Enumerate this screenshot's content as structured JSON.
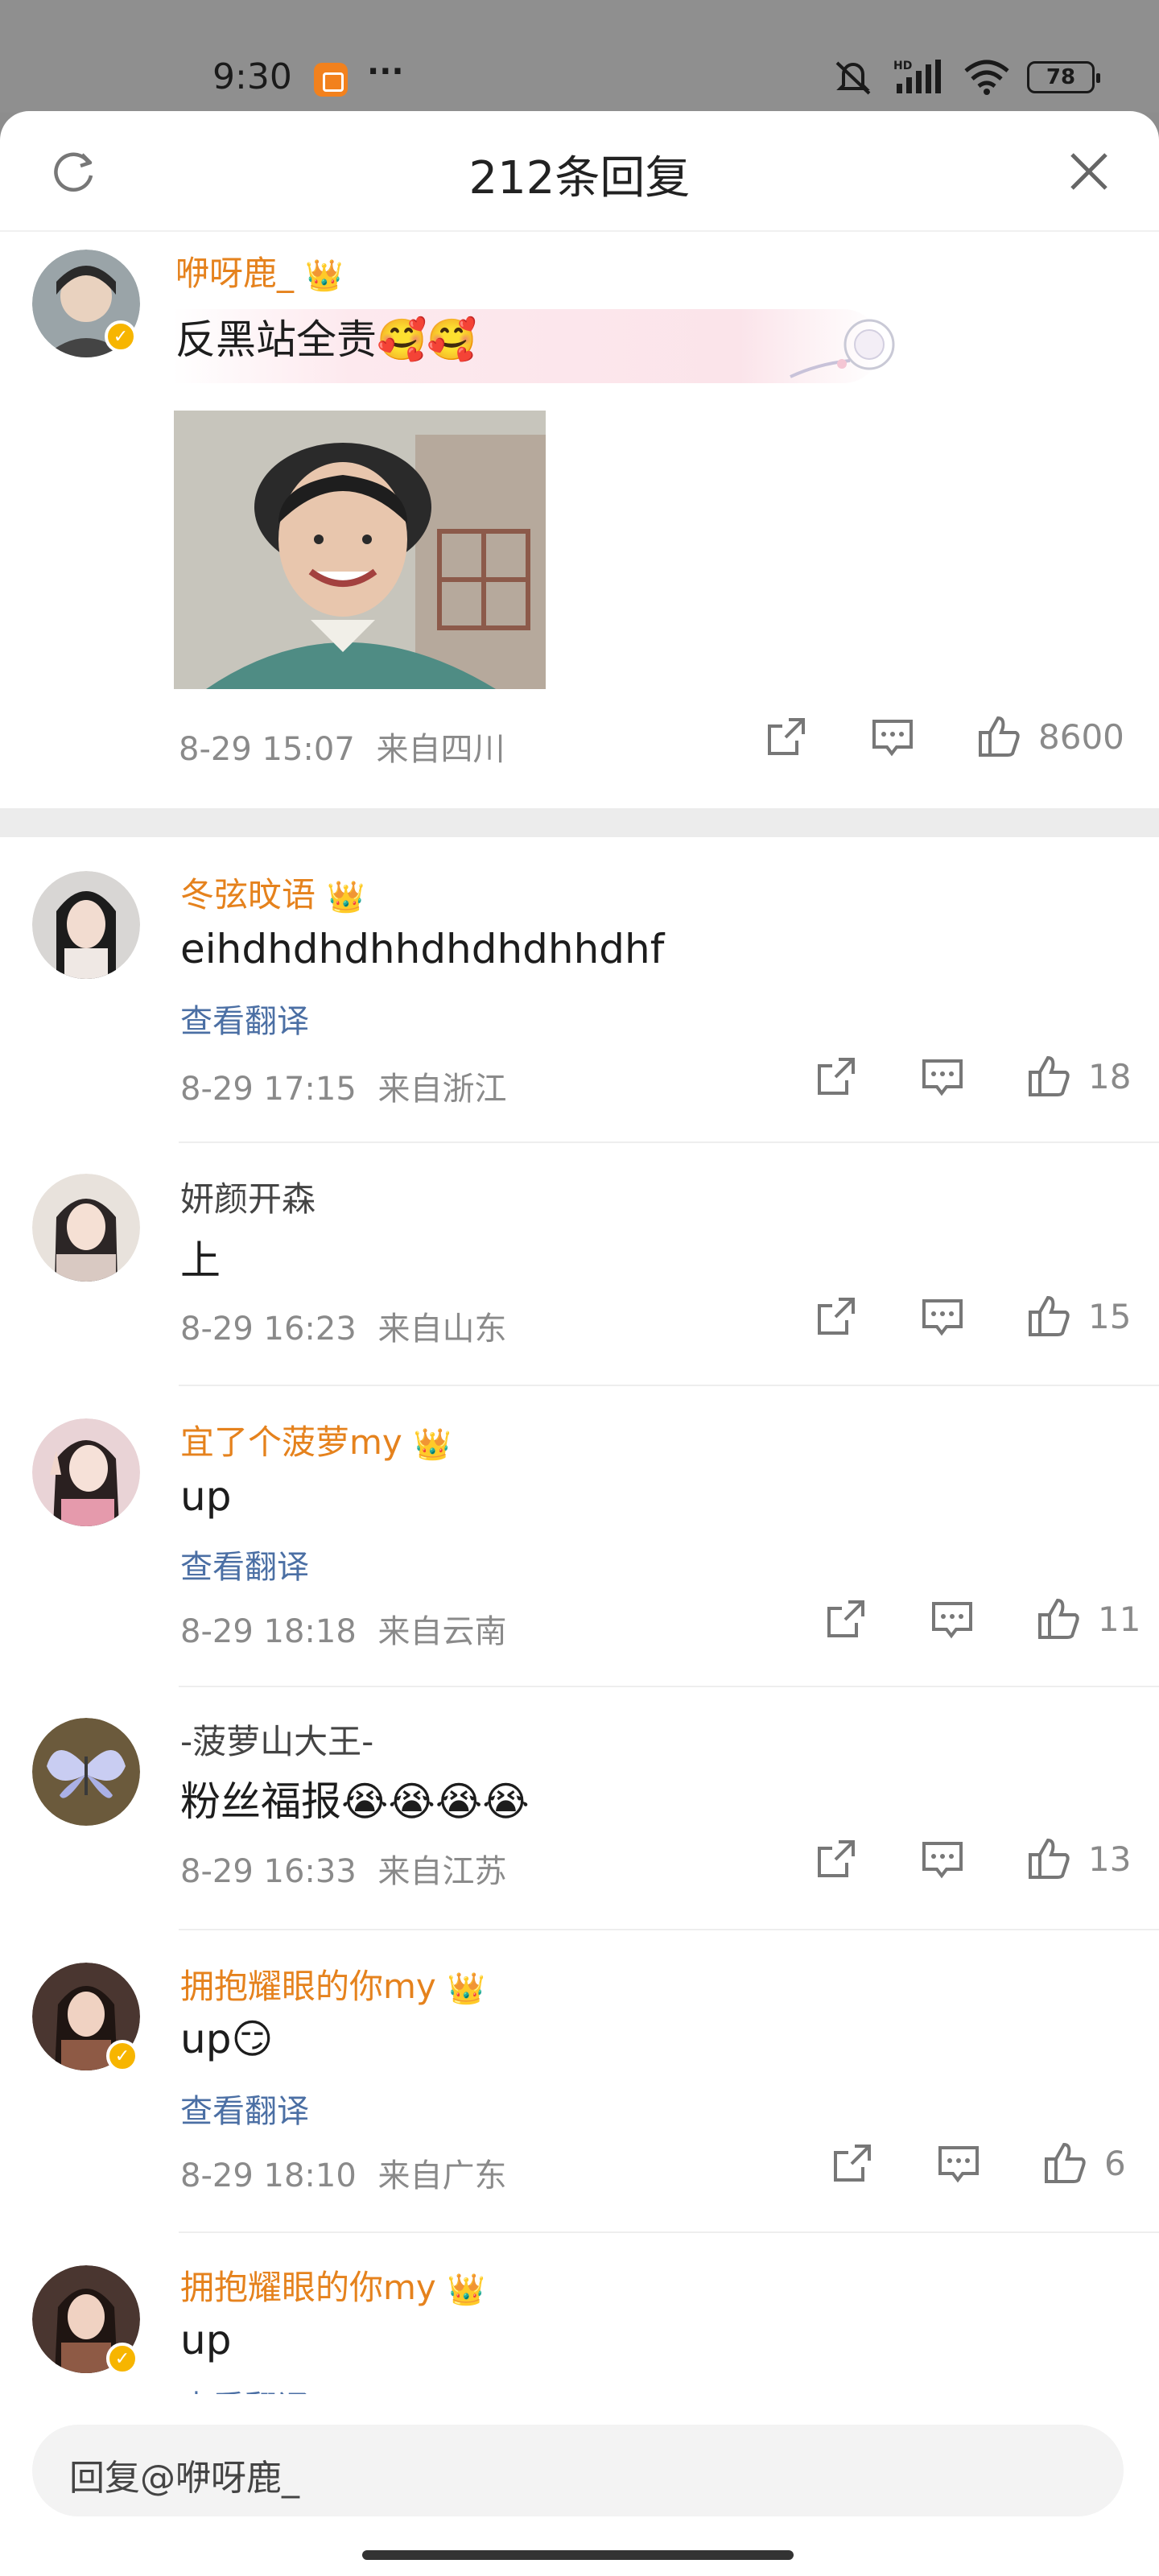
{
  "status_bar": {
    "time": "9:30",
    "dots": "···",
    "battery": "78",
    "icons": [
      "mute-icon",
      "hd-signal-icon",
      "wifi-icon",
      "battery-icon"
    ]
  },
  "header": {
    "title": "212条回复",
    "refresh_icon": "refresh-icon",
    "close_icon": "close-icon"
  },
  "main_comment": {
    "username": "咿呀鹿_",
    "text": "反黑站全责🥰🥰",
    "time": "8-29 15:07",
    "location": "来自四川",
    "likes": "8600"
  },
  "replies": [
    {
      "username": "冬弦旼语",
      "vip": true,
      "text": "eihdhdhdhhdhdhdhhdhf",
      "translate": "查看翻译",
      "time": "8-29 17:15",
      "location": "来自浙江",
      "likes": "18"
    },
    {
      "username": "妍颜开森",
      "vip": false,
      "text": "上",
      "translate": "",
      "time": "8-29 16:23",
      "location": "来自山东",
      "likes": "15"
    },
    {
      "username": "宜了个菠萝my",
      "vip": true,
      "text": "up",
      "translate": "查看翻译",
      "time": "8-29 18:18",
      "location": "来自云南",
      "likes": "11"
    },
    {
      "username": "-菠萝山大王-",
      "vip": false,
      "text": "粉丝福报😭😭😭😭",
      "translate": "",
      "time": "8-29 16:33",
      "location": "来自江苏",
      "likes": "13"
    },
    {
      "username": "拥抱耀眼的你my",
      "vip": true,
      "text": "up😏",
      "translate": "查看翻译",
      "time": "8-29 18:10",
      "location": "来自广东",
      "likes": "6"
    },
    {
      "username": "拥抱耀眼的你my",
      "vip": true,
      "text": "up",
      "translate": "查看翻译",
      "time": "",
      "location": "",
      "likes": ""
    }
  ],
  "reply_input": {
    "placeholder": "回复@咿呀鹿_"
  },
  "colors": {
    "vip_name": "#e5821d",
    "translate_link": "#4b6fa4",
    "meta": "#8a8a8a"
  }
}
